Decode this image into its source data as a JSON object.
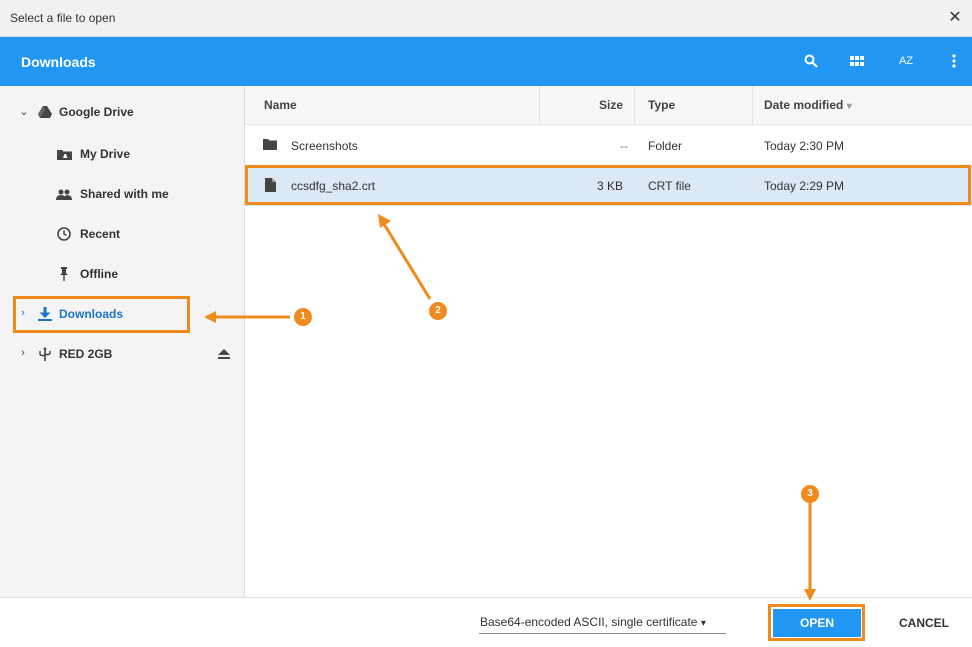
{
  "window": {
    "title": "Select a file to open",
    "close_icon": "close-icon"
  },
  "toolbar": {
    "path": "Downloads",
    "icons": [
      "search-icon",
      "grid-view-icon",
      "sort-az-icon",
      "more-vert-icon"
    ],
    "sort_label": "AZ"
  },
  "sidebar": {
    "items": [
      {
        "label": "Google Drive",
        "icon": "google-drive-icon",
        "expander": "chevron-down"
      },
      {
        "label": "My Drive",
        "icon": "folder-drive-icon"
      },
      {
        "label": "Shared with me",
        "icon": "people-icon"
      },
      {
        "label": "Recent",
        "icon": "clock-icon"
      },
      {
        "label": "Offline",
        "icon": "pin-icon"
      },
      {
        "label": "Downloads",
        "icon": "download-icon",
        "expander": "chevron-right",
        "selected": true
      },
      {
        "label": "RED 2GB",
        "icon": "usb-icon",
        "expander": "chevron-right",
        "action_icon": "eject-icon"
      }
    ]
  },
  "file_list": {
    "columns": {
      "name": "Name",
      "size": "Size",
      "type": "Type",
      "date": "Date modified",
      "sort_indicator": "▾"
    },
    "rows": [
      {
        "name": "Screenshots",
        "size": "--",
        "type": "Folder",
        "date": "Today 2:30 PM",
        "icon": "folder-icon"
      },
      {
        "name": "ccsdfg_sha2.crt",
        "size": "3 KB",
        "type": "CRT file",
        "date": "Today 2:29 PM",
        "icon": "file-icon",
        "selected": true
      }
    ]
  },
  "footer": {
    "filter_label": "Base64-encoded ASCII, single certificate",
    "filter_arrow": "▾",
    "open_label": "OPEN",
    "cancel_label": "CANCEL"
  },
  "annotations": {
    "badges": [
      "1",
      "2",
      "3"
    ],
    "accent": "#f08a1c"
  },
  "colors": {
    "toolbar": "#2196f3",
    "selection": "#dbe8f5",
    "active_text": "#1e73c8"
  }
}
